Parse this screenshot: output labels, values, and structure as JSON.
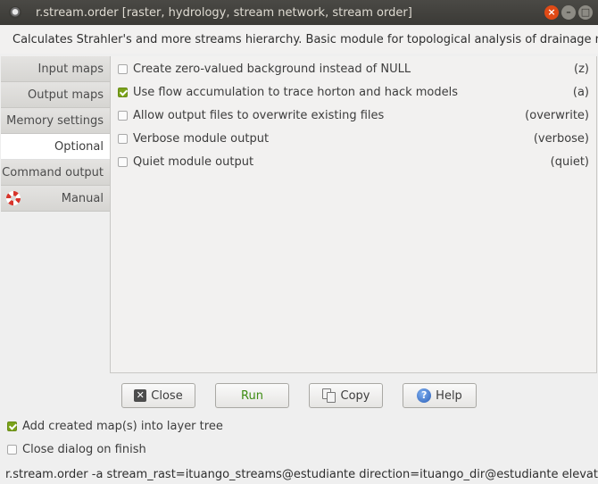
{
  "window": {
    "title": "r.stream.order [raster, hydrology, stream network, stream order]",
    "buttons": [
      "close",
      "minimize",
      "maximize"
    ]
  },
  "header": {
    "description": "Calculates Strahler's and more streams hierarchy. Basic module for topological analysis of drainage network"
  },
  "sidebar": {
    "tabs": [
      {
        "label": "Input maps",
        "active": false
      },
      {
        "label": "Output maps",
        "active": false
      },
      {
        "label": "Memory settings",
        "active": false
      },
      {
        "label": "Optional",
        "active": true
      },
      {
        "label": "Command output",
        "active": false
      },
      {
        "label": "Manual",
        "active": false,
        "icon": "lifebuoy-icon"
      }
    ]
  },
  "options": [
    {
      "label": "Create zero-valued background instead of NULL",
      "flag": "(z)",
      "checked": false
    },
    {
      "label": "Use flow accumulation to trace horton and hack models",
      "flag": "(a)",
      "checked": true
    },
    {
      "label": "Allow output files to overwrite existing files",
      "flag": "(overwrite)",
      "checked": false
    },
    {
      "label": "Verbose module output",
      "flag": "(verbose)",
      "checked": false
    },
    {
      "label": "Quiet module output",
      "flag": "(quiet)",
      "checked": false
    }
  ],
  "buttons": {
    "close": "Close",
    "run": "Run",
    "copy": "Copy",
    "help": "Help"
  },
  "bottom_options": {
    "add_to_tree": {
      "label": "Add created map(s) into layer tree",
      "checked": true
    },
    "close_on_finish": {
      "label": "Close dialog on finish",
      "checked": false
    }
  },
  "command_line": "r.stream.order -a stream_rast=ituango_streams@estudiante direction=ituango_dir@estudiante elevation=ituango"
}
